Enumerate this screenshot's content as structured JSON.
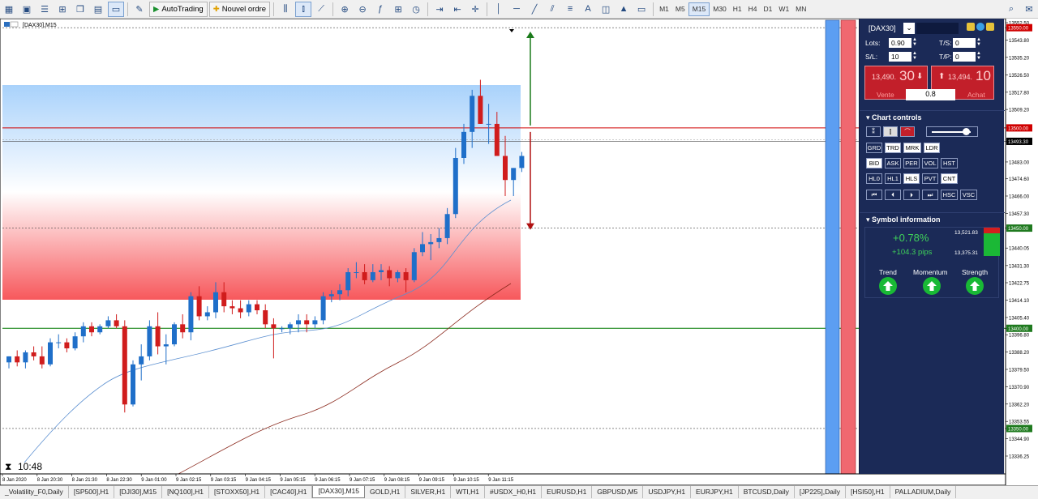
{
  "toolbar": {
    "autotrading_label": "AutoTrading",
    "new_order_label": "Nouvel ordre",
    "timeframes": [
      "M1",
      "M5",
      "M15",
      "M30",
      "H1",
      "H4",
      "D1",
      "W1",
      "MN"
    ],
    "active_timeframe": "M15"
  },
  "chart": {
    "symbol_label": "[DAX30],M15",
    "clock": "10:48",
    "colors": {
      "bull": "#1f6fc9",
      "bear": "#d01c1c",
      "ma_fast": "#5b8fd0",
      "ma_slow": "#8b2a1e",
      "resist": "#d00000",
      "support": "#007a00"
    },
    "price_axis": [
      {
        "value": "13552.50",
        "p": 13552.5
      },
      {
        "value": "13550.00",
        "p": 13550.0,
        "tag": "red"
      },
      {
        "value": "13543.80",
        "p": 13543.8
      },
      {
        "value": "13535.20",
        "p": 13535.2
      },
      {
        "value": "13526.50",
        "p": 13526.5
      },
      {
        "value": "13517.80",
        "p": 13517.8
      },
      {
        "value": "13509.20",
        "p": 13509.2
      },
      {
        "value": "13500.00",
        "p": 13500.0,
        "tag": "red"
      },
      {
        "value": "13493.30",
        "p": 13493.3,
        "tag": "dark"
      },
      {
        "value": "13483.00",
        "p": 13483.0
      },
      {
        "value": "13474.60",
        "p": 13474.6
      },
      {
        "value": "13466.00",
        "p": 13466.0
      },
      {
        "value": "13457.30",
        "p": 13457.3
      },
      {
        "value": "13450.00",
        "p": 13450.0,
        "tag": "green"
      },
      {
        "value": "13440.05",
        "p": 13440.05
      },
      {
        "value": "13431.30",
        "p": 13431.3
      },
      {
        "value": "13422.75",
        "p": 13422.75
      },
      {
        "value": "13414.10",
        "p": 13414.1
      },
      {
        "value": "13405.40",
        "p": 13405.4
      },
      {
        "value": "13400.00",
        "p": 13400.0,
        "tag": "green"
      },
      {
        "value": "13396.80",
        "p": 13396.8
      },
      {
        "value": "13388.20",
        "p": 13388.2
      },
      {
        "value": "13379.50",
        "p": 13379.5
      },
      {
        "value": "13370.90",
        "p": 13370.9
      },
      {
        "value": "13362.20",
        "p": 13362.2
      },
      {
        "value": "13353.55",
        "p": 13353.55
      },
      {
        "value": "13350.00",
        "p": 13350.0,
        "tag": "green"
      },
      {
        "value": "13344.90",
        "p": 13344.9
      },
      {
        "value": "13336.25",
        "p": 13336.25
      }
    ],
    "time_axis": [
      "8 Jan 2020",
      "8 Jan 20:30",
      "8 Jan 21:30",
      "8 Jan 22:30",
      "9 Jan 01:00",
      "9 Jan 02:15",
      "9 Jan 03:15",
      "9 Jan 04:15",
      "9 Jan 05:15",
      "9 Jan 06:15",
      "9 Jan 07:15",
      "9 Jan 08:15",
      "9 Jan 09:15",
      "9 Jan 10:15",
      "9 Jan 11:15"
    ],
    "candles": [
      [
        13383,
        13386,
        13380,
        13386
      ],
      [
        13386,
        13389,
        13381,
        13383
      ],
      [
        13383,
        13389,
        13380,
        13388
      ],
      [
        13388,
        13391,
        13384,
        13386
      ],
      [
        13386,
        13391,
        13380,
        13382
      ],
      [
        13382,
        13395,
        13381,
        13393
      ],
      [
        13393,
        13397,
        13390,
        13393
      ],
      [
        13393,
        13395,
        13388,
        13390
      ],
      [
        13390,
        13398,
        13389,
        13396
      ],
      [
        13396,
        13403,
        13393,
        13401
      ],
      [
        13401,
        13403,
        13396,
        13398
      ],
      [
        13398,
        13402,
        13397,
        13401
      ],
      [
        13401,
        13406,
        13400,
        13404
      ],
      [
        13404,
        13407,
        13400,
        13401
      ],
      [
        13401,
        13404,
        13358,
        13362
      ],
      [
        13362,
        13384,
        13361,
        13382
      ],
      [
        13382,
        13392,
        13374,
        13386
      ],
      [
        13386,
        13404,
        13384,
        13401
      ],
      [
        13401,
        13408,
        13387,
        13391
      ],
      [
        13391,
        13397,
        13382,
        13392
      ],
      [
        13392,
        13403,
        13391,
        13402
      ],
      [
        13402,
        13407,
        13395,
        13398
      ],
      [
        13398,
        13418,
        13394,
        13416
      ],
      [
        13416,
        13421,
        13404,
        13406
      ],
      [
        13406,
        13411,
        13404,
        13408
      ],
      [
        13408,
        13423,
        13405,
        13418
      ],
      [
        13418,
        13423,
        13408,
        13411
      ],
      [
        13411,
        13414,
        13407,
        13410
      ],
      [
        13410,
        13414,
        13405,
        13408
      ],
      [
        13408,
        13414,
        13406,
        13412
      ],
      [
        13412,
        13414,
        13407,
        13409
      ],
      [
        13409,
        13412,
        13400,
        13402
      ],
      [
        13402,
        13405,
        13385,
        13400
      ],
      [
        13400,
        13401,
        13398,
        13400
      ],
      [
        13400,
        13403,
        13397,
        13402
      ],
      [
        13402,
        13407,
        13398,
        13404
      ],
      [
        13404,
        13407,
        13398,
        13402
      ],
      [
        13402,
        13406,
        13400,
        13404
      ],
      [
        13404,
        13418,
        13402,
        13416
      ],
      [
        13416,
        13419,
        13413,
        13417
      ],
      [
        13417,
        13422,
        13414,
        13419
      ],
      [
        13419,
        13430,
        13416,
        13428
      ],
      [
        13428,
        13433,
        13425,
        13428
      ],
      [
        13428,
        13432,
        13422,
        13424
      ],
      [
        13424,
        13432,
        13423,
        13428
      ],
      [
        13428,
        13432,
        13424,
        13429
      ],
      [
        13429,
        13431,
        13421,
        13425
      ],
      [
        13425,
        13429,
        13423,
        13428
      ],
      [
        13428,
        13430,
        13418,
        13424
      ],
      [
        13424,
        13440,
        13423,
        13438
      ],
      [
        13438,
        13448,
        13436,
        13442
      ],
      [
        13442,
        13447,
        13434,
        13443
      ],
      [
        13443,
        13450,
        13440,
        13445
      ],
      [
        13445,
        13460,
        13442,
        13457
      ],
      [
        13457,
        13490,
        13455,
        13485
      ],
      [
        13485,
        13502,
        13482,
        13498
      ],
      [
        13498,
        13519,
        13490,
        13516
      ],
      [
        13516,
        13524,
        13502,
        13502
      ],
      [
        13502,
        13512,
        13492,
        13502
      ],
      [
        13502,
        13508,
        13490,
        13486
      ],
      [
        13486,
        13496,
        13466,
        13474
      ],
      [
        13474,
        13480,
        13466,
        13480
      ],
      [
        13480,
        13488,
        13478,
        13486
      ]
    ]
  },
  "panel": {
    "symbol": "[DAX30]",
    "lots_label": "Lots:",
    "lots": "0.90",
    "ts_label": "T/S:",
    "ts": "0",
    "sl_label": "S/L:",
    "sl": "10",
    "tp_label": "T/P:",
    "tp": "0",
    "sell_price_small": "13,490.",
    "sell_price_big": "30",
    "sell_label": "Vente",
    "buy_price_small": "13,494.",
    "buy_price_big": "10",
    "buy_label": "Achat",
    "spread": "0.8",
    "chart_controls_title": "Chart controls",
    "row1": [
      "GRD",
      "TRD",
      "MRK",
      "LDR"
    ],
    "row2": [
      "BID",
      "ASK",
      "PER",
      "VOL",
      "HST"
    ],
    "row3": [
      "HL0",
      "HL1",
      "HLS",
      "PVT",
      "CNT"
    ],
    "row4": [
      "⏮",
      "⏴",
      "⏵",
      "⏭",
      "HSC",
      "VSC"
    ],
    "symbol_info_title": "Symbol information",
    "change_pct": "+0.78%",
    "change_pips": "+104.3 pips",
    "range_high": "13,521.83",
    "range_low": "13,375.31",
    "trend_label": "Trend",
    "momentum_label": "Momentum",
    "strength_label": "Strength"
  },
  "tabs": [
    "_Volatility_F0,Daily",
    "[SP500],H1",
    "[DJI30],M15",
    "[NQ100],H1",
    "[STOXX50],H1",
    "[CAC40],H1",
    "[DAX30],M15",
    "GOLD,H1",
    "SILVER,H1",
    "WTI,H1",
    "#USDX_H0,H1",
    "EURUSD,H1",
    "GBPUSD,M5",
    "USDJPY,H1",
    "EURJPY,H1",
    "BTCUSD,Daily",
    "[JP225],Daily",
    "[HSI50],H1",
    "PALLADIUM,Daily"
  ],
  "active_tab": "[DAX30],M15"
}
